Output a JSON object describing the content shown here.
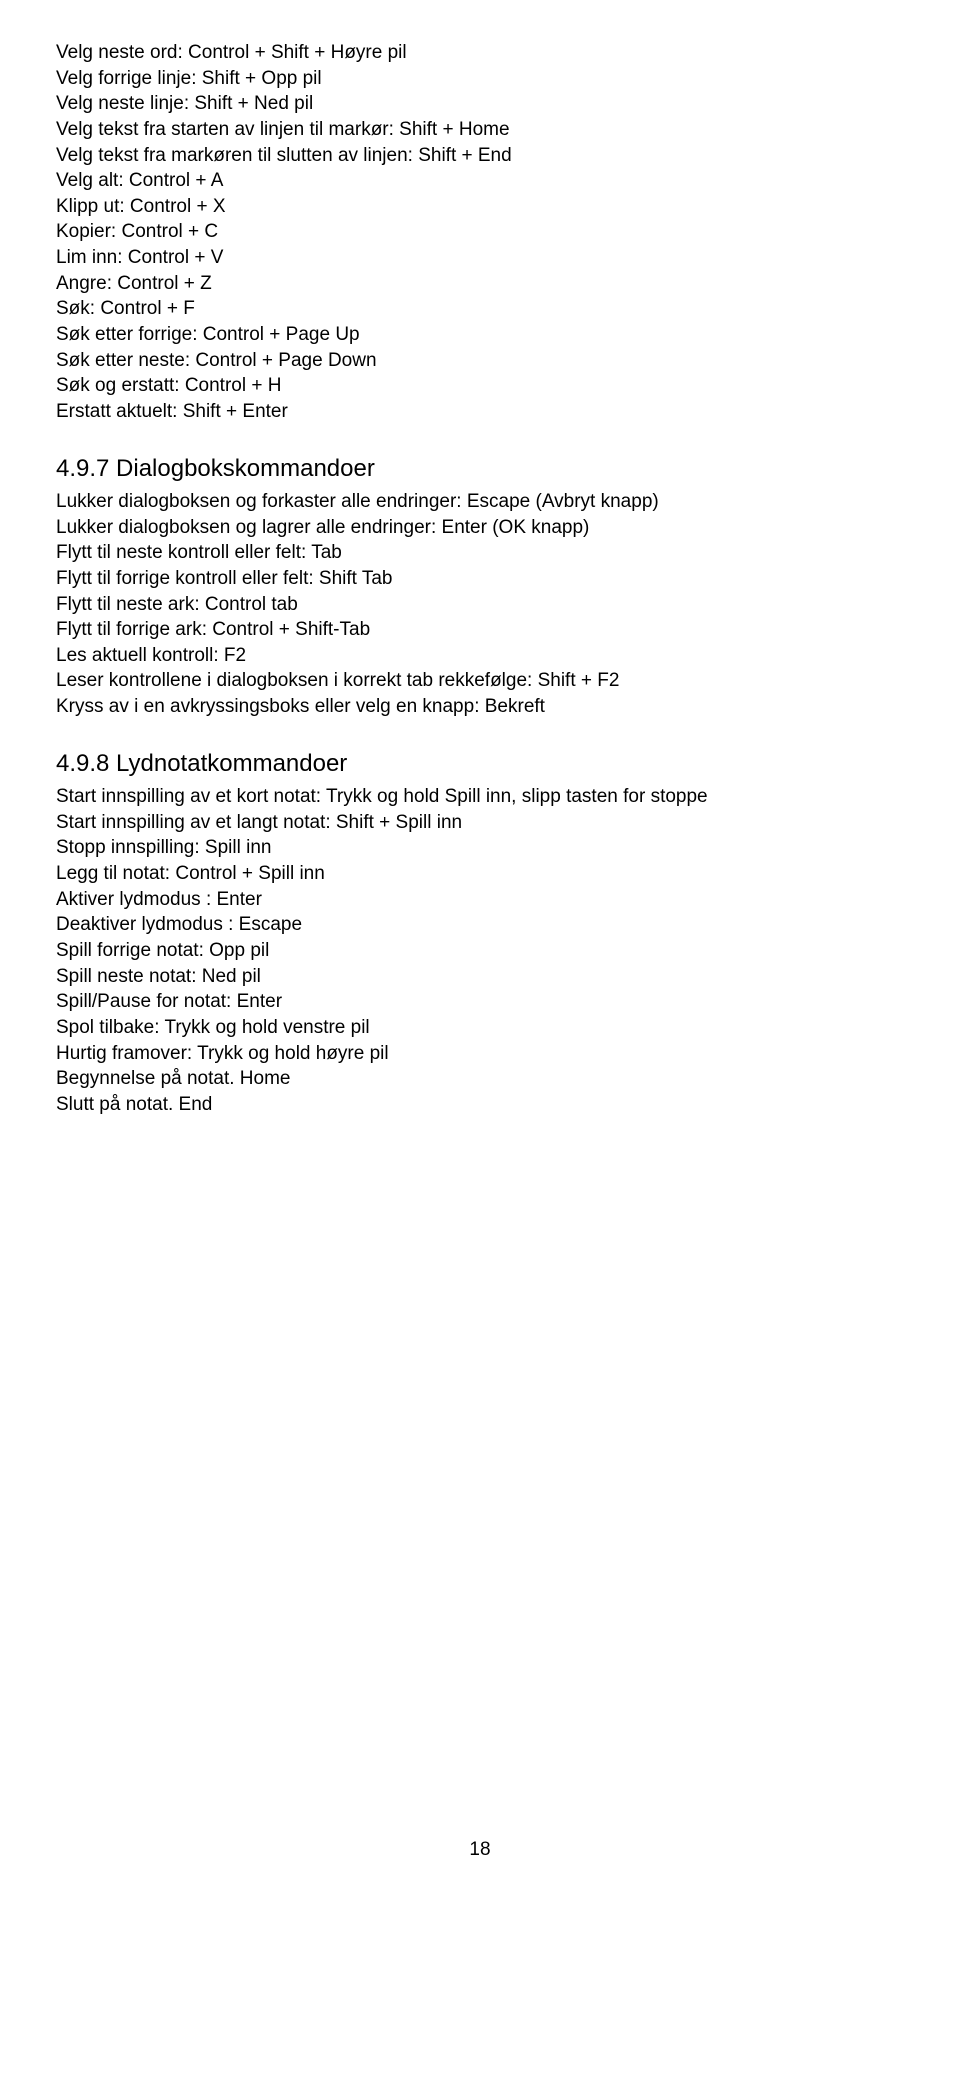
{
  "section1": {
    "lines": [
      "Velg neste ord: Control + Shift + Høyre pil",
      "Velg forrige linje: Shift + Opp pil",
      "Velg neste linje: Shift + Ned pil",
      "Velg tekst fra starten av linjen til markør: Shift + Home",
      "Velg tekst fra markøren til slutten av linjen: Shift + End",
      "Velg alt: Control + A",
      "Klipp ut: Control + X",
      "Kopier: Control + C",
      "Lim inn: Control + V",
      "Angre: Control + Z",
      "Søk: Control + F",
      "Søk etter forrige: Control + Page Up",
      "Søk etter neste: Control + Page Down",
      "Søk og erstatt: Control + H",
      "Erstatt aktuelt: Shift + Enter"
    ]
  },
  "section2": {
    "heading": "4.9.7   Dialogbokskommandoer",
    "lines": [
      "Lukker dialogboksen og forkaster alle endringer: Escape (Avbryt knapp)",
      "Lukker dialogboksen og lagrer alle endringer: Enter (OK knapp)",
      "Flytt til neste kontroll eller felt: Tab",
      "Flytt til forrige kontroll eller felt: Shift Tab",
      "Flytt til neste ark: Control tab",
      "Flytt til forrige ark: Control + Shift-Tab",
      "Les aktuell kontroll: F2",
      "Leser kontrollene i dialogboksen i korrekt tab rekkefølge: Shift + F2",
      "Kryss av i en avkryssingsboks eller velg en knapp: Bekreft"
    ]
  },
  "section3": {
    "heading": "4.9.8   Lydnotatkommandoer",
    "lines": [
      "Start innspilling av et kort notat: Trykk og hold Spill inn, slipp tasten for stoppe",
      "Start innspilling av et langt notat: Shift + Spill inn",
      "Stopp innspilling: Spill inn",
      "Legg til notat: Control + Spill inn",
      "Aktiver lydmodus : Enter",
      "Deaktiver lydmodus : Escape",
      "Spill forrige notat: Opp pil",
      "Spill neste notat: Ned pil",
      "Spill/Pause for notat: Enter",
      "Spol tilbake: Trykk og hold venstre pil",
      "Hurtig framover: Trykk og hold høyre pil",
      "Begynnelse på notat. Home",
      "Slutt på notat. End"
    ]
  },
  "page_number": "18"
}
